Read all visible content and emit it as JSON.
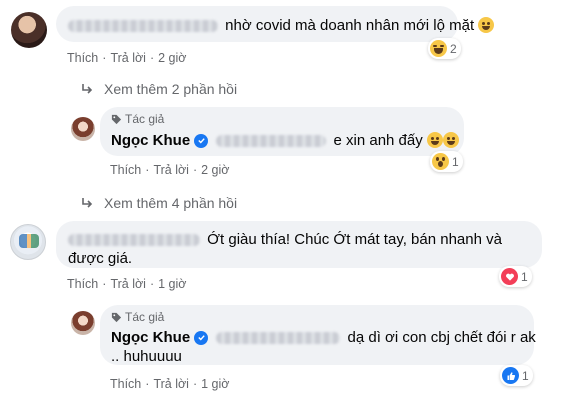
{
  "comments": [
    {
      "text": "nhờ covid mà doanh nhân mới lộ mặt",
      "actions": {
        "like": "Thích",
        "reply": "Trả lời",
        "time": "2 giờ"
      },
      "reaction_count": "2",
      "reaction_icon": "haha-icon"
    },
    {
      "more_replies": "Xem thêm 2 phần hồi",
      "author_badge": "Tác giả",
      "author": "Ngọc Khue",
      "text": "e xin anh đấy",
      "actions": {
        "like": "Thích",
        "reply": "Trả lời",
        "time": "2 giờ"
      },
      "reaction_count": "1",
      "reaction_icon": "wow-icon"
    },
    {
      "more_replies": "Xem thêm 4 phần hồi",
      "text_line1": "Ớt giàu thía! Chúc Ớt mát tay, bán nhanh và",
      "text_line2": "được giá.",
      "actions": {
        "like": "Thích",
        "reply": "Trả lời",
        "time": "1 giờ"
      },
      "reaction_count": "1",
      "reaction_icon": "love-icon"
    },
    {
      "author_badge": "Tác giả",
      "author": "Ngọc Khue",
      "text_line1": "dạ dì ơi con cbj chết đói r ak",
      "text_line2": ".. huhuuuu",
      "actions": {
        "like": "Thích",
        "reply": "Trả lời",
        "time": "1 giờ"
      },
      "reaction_count": "1",
      "reaction_icon": "like-icon"
    }
  ],
  "colors": {
    "bubble": "#f0f2f5",
    "meta": "#65676b",
    "verified": "#1877f2",
    "love": "#f33e58",
    "like": "#1877f2"
  }
}
